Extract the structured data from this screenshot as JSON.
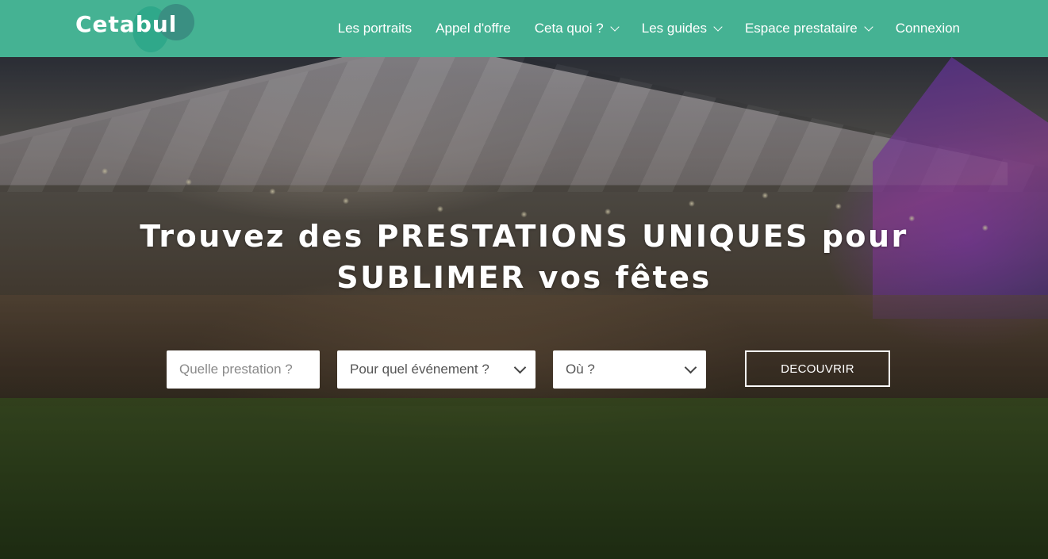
{
  "header": {
    "logo_text": "Cetabul",
    "nav": [
      {
        "label": "Les portraits",
        "has_dropdown": false
      },
      {
        "label": "Appel d'offre",
        "has_dropdown": false
      },
      {
        "label": "Ceta quoi ?",
        "has_dropdown": true
      },
      {
        "label": "Les guides",
        "has_dropdown": true
      },
      {
        "label": "Espace prestataire",
        "has_dropdown": true
      },
      {
        "label": "Connexion",
        "has_dropdown": false
      }
    ]
  },
  "hero": {
    "headline_line1": "Trouvez des PRESTATIONS UNIQUES pour",
    "headline_line2": "SUBLIMER vos fêtes",
    "search": {
      "prestation_placeholder": "Quelle prestation ?",
      "event_select": "Pour quel événement ?",
      "location_select": "Où ?"
    },
    "cta_label": "DECOUVRIR"
  },
  "colors": {
    "brand": "#45b293",
    "white": "#ffffff"
  }
}
